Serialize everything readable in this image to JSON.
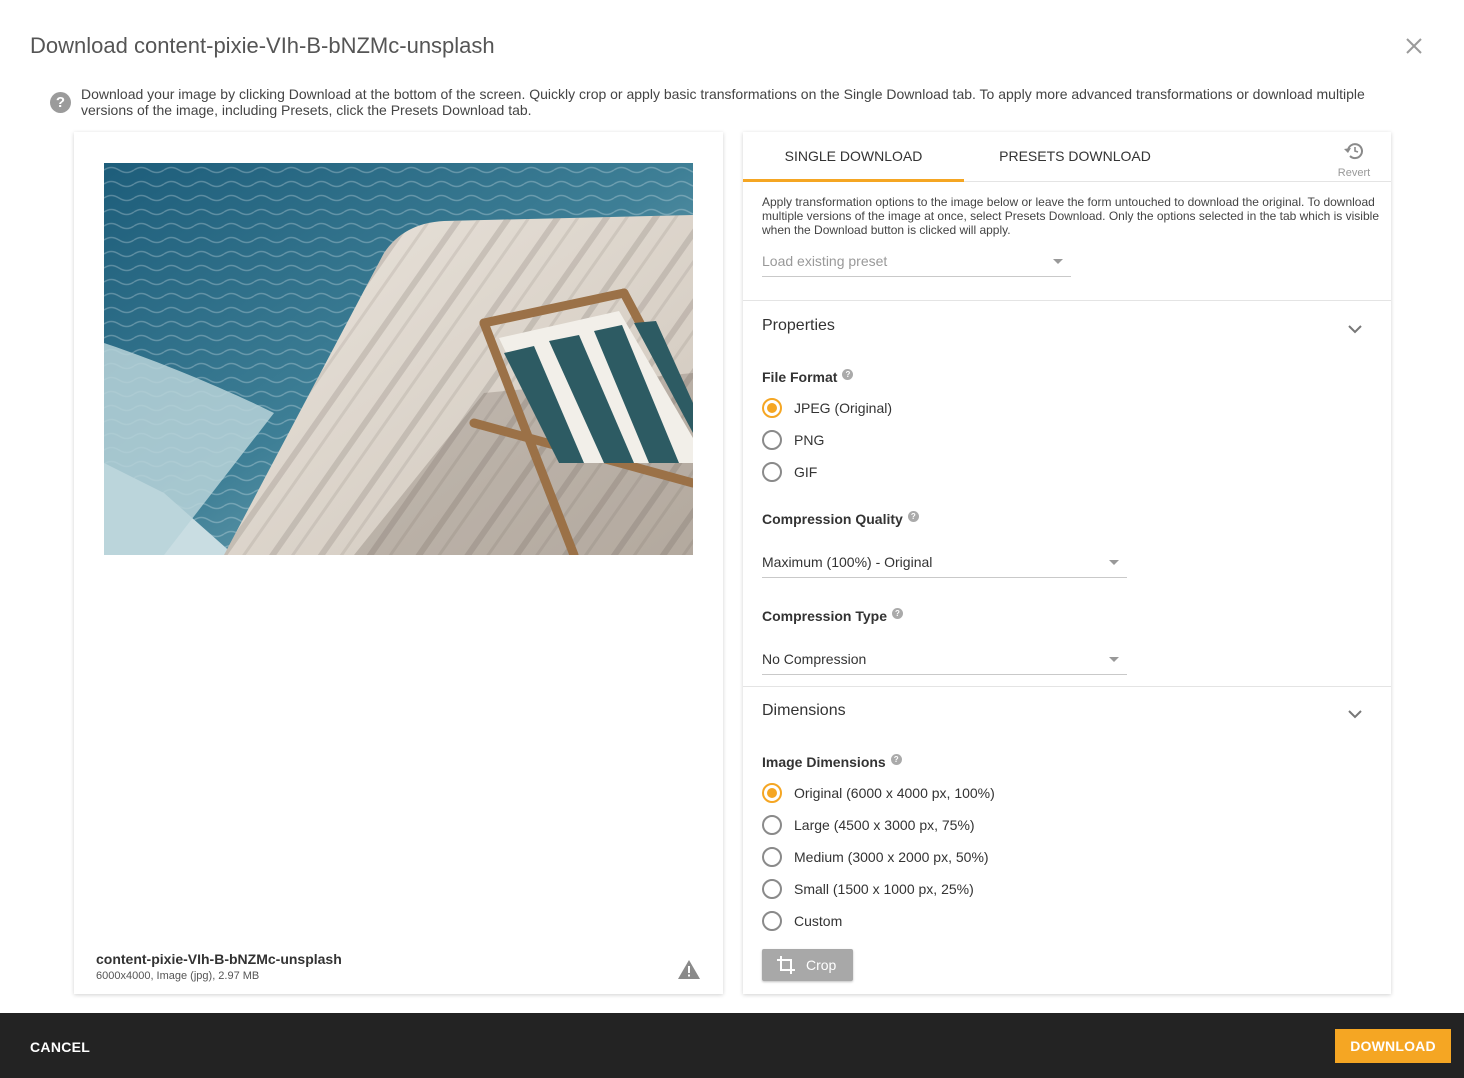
{
  "dialog": {
    "title": "Download content-pixie-VIh-B-bNZMc-unsplash",
    "info_text": "Download your image by clicking Download at the bottom of the screen. Quickly crop or apply basic transformations on the Single Download tab. To apply more advanced transformations or download multiple versions of the image, including Presets, click the Presets Download tab."
  },
  "preview": {
    "file_name": "content-pixie-VIh-B-bNZMc-unsplash",
    "file_meta": "6000x4000, Image (jpg), 2.97 MB"
  },
  "tabs": {
    "single": "SINGLE DOWNLOAD",
    "presets": "PRESETS DOWNLOAD",
    "revert": "Revert",
    "active": "single"
  },
  "single": {
    "description": "Apply transformation options to the image below or leave the form untouched to download the original. To download multiple versions of the image at once, select Presets Download. Only the options selected in the tab which is visible when the Download button is clicked will apply.",
    "preset_placeholder": "Load existing preset"
  },
  "properties": {
    "title": "Properties",
    "file_format_label": "File Format",
    "file_formats": [
      "JPEG (Original)",
      "PNG",
      "GIF"
    ],
    "file_format_selected": 0,
    "compression_quality_label": "Compression Quality",
    "compression_quality_value": "Maximum (100%) - Original",
    "compression_type_label": "Compression Type",
    "compression_type_value": "No Compression"
  },
  "dimensions": {
    "title": "Dimensions",
    "image_dimensions_label": "Image Dimensions",
    "options": [
      "Original (6000 x 4000 px, 100%)",
      "Large (4500 x 3000 px, 75%)",
      "Medium (3000 x 2000 px, 50%)",
      "Small (1500 x 1000 px, 25%)",
      "Custom"
    ],
    "selected": 0,
    "crop_label": "Crop"
  },
  "footer": {
    "cancel_label": "CANCEL",
    "download_label": "DOWNLOAD"
  },
  "colors": {
    "accent": "#f5a623",
    "footer_bg": "#232323"
  }
}
